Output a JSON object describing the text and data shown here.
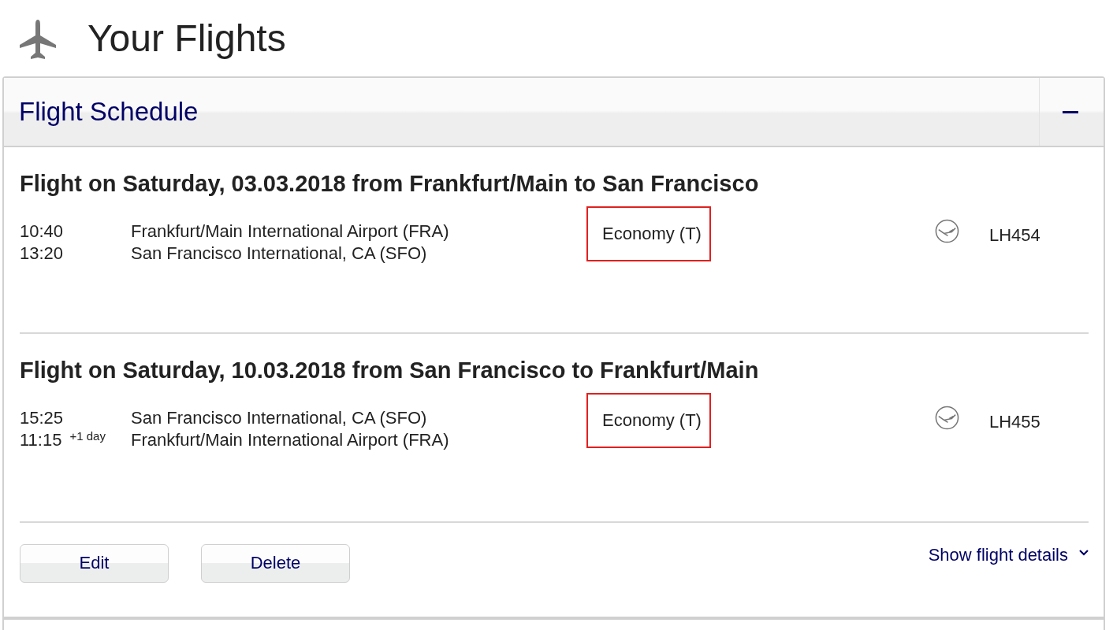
{
  "page_title": "Your Flights",
  "panel": {
    "title": "Flight Schedule",
    "expanded": true,
    "flights": [
      {
        "heading": "Flight on Saturday, 03.03.2018 from Frankfurt/Main to San Francisco",
        "departure_time": "10:40",
        "departure_airport": "Frankfurt/Main International Airport (FRA)",
        "arrival_time": "13:20",
        "arrival_airport": "San Francisco International, CA (SFO)",
        "cabin_class": "Economy (T)",
        "class_highlighted": true,
        "flight_number": "LH454"
      },
      {
        "heading": "Flight on Saturday, 10.03.2018 from San Francisco to Frankfurt/Main",
        "departure_time": "15:25",
        "departure_airport": "San Francisco International, CA (SFO)",
        "arrival_time": "11:15",
        "arrival_day_offset": "+1 day",
        "arrival_airport": "Frankfurt/Main International Airport (FRA)",
        "cabin_class": "Economy (T)",
        "class_highlighted": true,
        "flight_number": "LH455"
      }
    ],
    "buttons": [
      "Edit",
      "Delete"
    ],
    "details_link": "Show flight details"
  }
}
